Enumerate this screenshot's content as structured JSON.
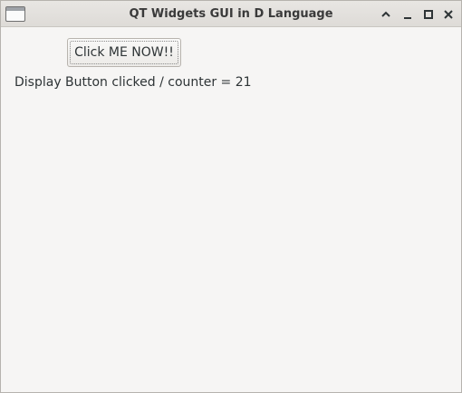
{
  "window": {
    "title": "QT Widgets GUI in D Language",
    "controls": {
      "minimize_icon": "chevron-up-icon",
      "iconify_icon": "minus-icon",
      "maximize_icon": "square-icon",
      "close_icon": "close-icon"
    }
  },
  "main": {
    "button_label": "Click ME NOW!!",
    "display_label": "Display",
    "display_value": "Button clicked / counter = 21"
  }
}
